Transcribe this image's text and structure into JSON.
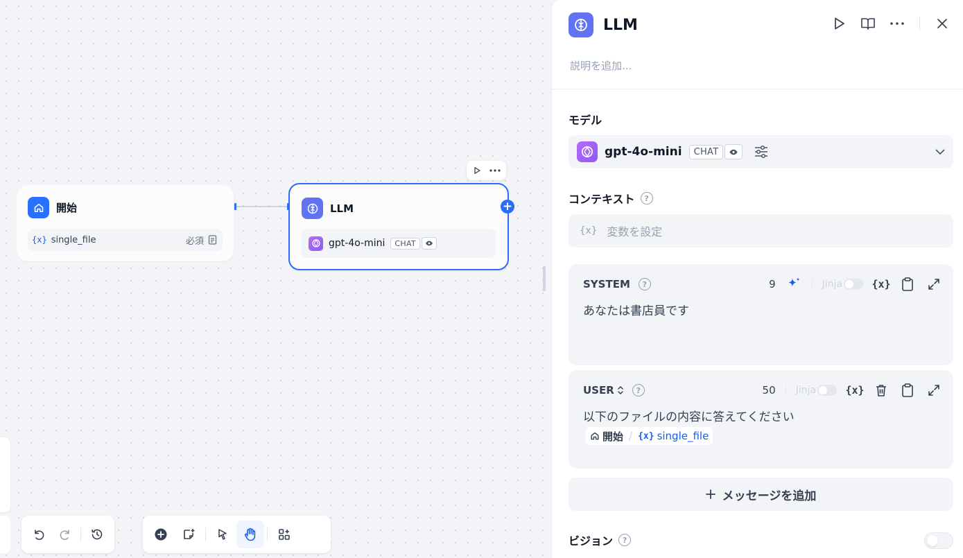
{
  "canvas": {
    "start_node": {
      "title": "開始",
      "variable": {
        "tag": "{x}",
        "name": "single_file",
        "required_label": "必須"
      }
    },
    "llm_node": {
      "title": "LLM",
      "model": {
        "name": "gpt-4o-mini",
        "mode_badge": "CHAT"
      }
    }
  },
  "panel": {
    "title": "LLM",
    "description_placeholder": "説明を追加...",
    "model_section": {
      "label": "モデル",
      "model_name": "gpt-4o-mini",
      "mode_badge": "CHAT"
    },
    "context_section": {
      "label": "コンテキスト",
      "variable_tag": "{x}",
      "placeholder": "変数を設定"
    },
    "prompts": [
      {
        "role": "SYSTEM",
        "count": "9",
        "jinja_label": "Jinja",
        "text": "あなたは書店員です"
      },
      {
        "role": "USER",
        "count": "50",
        "jinja_label": "Jinja",
        "text": "以下のファイルの内容に答えてください",
        "reference": {
          "node": "開始",
          "separator": "/",
          "variable_tag": "{x}",
          "variable": "single_file"
        }
      }
    ],
    "add_message_label": "メッセージを追加",
    "vision_section": {
      "label": "ビジョン",
      "enabled": false
    }
  },
  "icons": {
    "var_icon": "{x}"
  },
  "colors": {
    "accent": "#296dff",
    "llm_icon": "#6172f3",
    "start_icon": "#2970ff",
    "openai_icon": "#a855f7"
  }
}
